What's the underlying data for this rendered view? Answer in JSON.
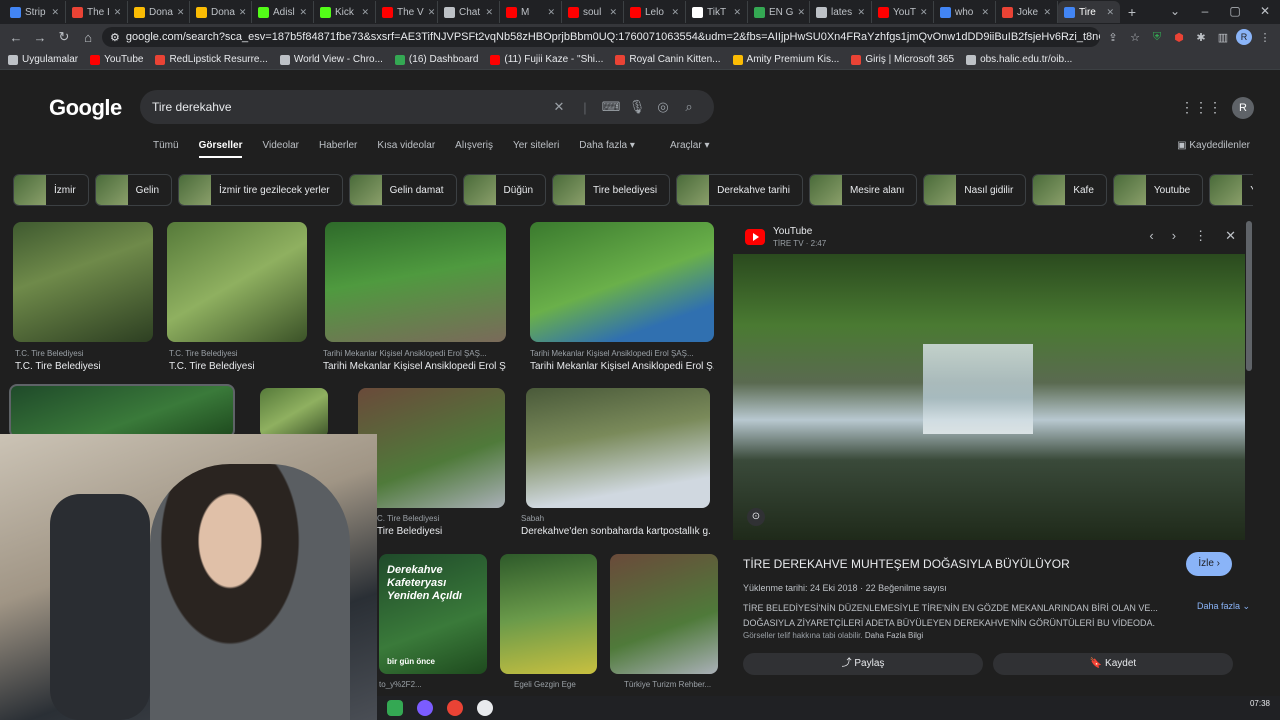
{
  "browser": {
    "tabs": [
      {
        "label": "Strip",
        "color": "#4285f4"
      },
      {
        "label": "The I",
        "color": "#ea4335"
      },
      {
        "label": "Dona",
        "color": "#fbbc04"
      },
      {
        "label": "Dona",
        "color": "#fbbc04"
      },
      {
        "label": "Adisl",
        "color": "#53fc18"
      },
      {
        "label": "Kick",
        "color": "#53fc18"
      },
      {
        "label": "The V",
        "color": "#ff0000"
      },
      {
        "label": "Chat",
        "color": "#bdc1c6"
      },
      {
        "label": "M",
        "color": "#ff0000"
      },
      {
        "label": "soul",
        "color": "#ff0000"
      },
      {
        "label": "Lelo",
        "color": "#ff0000"
      },
      {
        "label": "TikT",
        "color": "#ffffff"
      },
      {
        "label": "EN G",
        "color": "#34a853"
      },
      {
        "label": "lates",
        "color": "#bdc1c6"
      },
      {
        "label": "YouT",
        "color": "#ff0000"
      },
      {
        "label": "who",
        "color": "#4285f4"
      },
      {
        "label": "Joke",
        "color": "#ea4335"
      },
      {
        "label": "Tire",
        "color": "#4285f4",
        "active": true
      }
    ],
    "url": "google.com/search?sca_esv=187b5f84871fbe73&sxsrf=AE3TifNJVPSFt2vqNb58zHBOprjbBbm0UQ:1760071063554&udm=2&fbs=AIIjpHwSU0Xn4FRaYzhfgs1jmQvOnw1dDD9iiBuIB2fsjeHv6Rzi_t8nCYrA3VAYvcClsvbRO6GKb...",
    "bookmarks": [
      {
        "label": "Uygulamalar",
        "color": "#bdc1c6"
      },
      {
        "label": "YouTube",
        "color": "#ff0000"
      },
      {
        "label": "RedLipstick Resurre...",
        "color": "#ea4335"
      },
      {
        "label": "World View - Chro...",
        "color": "#bdc1c6"
      },
      {
        "label": "(16) Dashboard",
        "color": "#34a853"
      },
      {
        "label": "(11) Fujii Kaze - \"Shi...",
        "color": "#ff0000"
      },
      {
        "label": "Royal Canin Kitten...",
        "color": "#ea4335"
      },
      {
        "label": "Amity Premium Kis...",
        "color": "#fbbc04"
      },
      {
        "label": "Giriş | Microsoft 365",
        "color": "#ea4335"
      },
      {
        "label": "obs.halic.edu.tr/oib...",
        "color": "#bdc1c6"
      }
    ]
  },
  "google": {
    "logo": "Google",
    "query": "Tire derekahve",
    "tabs": [
      "Tümü",
      "Görseller",
      "Videolar",
      "Haberler",
      "Kısa videolar",
      "Alışveriş",
      "Yer siteleri",
      "Daha fazla ▾"
    ],
    "tools": "Araçlar ▾",
    "saved": "Kaydedilenler",
    "chips": [
      "İzmir",
      "Gelin",
      "İzmir tire gezilecek yerler",
      "Gelin damat",
      "Düğün",
      "Tire belediyesi",
      "Derekahve tarihi",
      "Mesire alanı",
      "Nasıl gidilir",
      "Kafe",
      "Youtube",
      "Yol tarifi"
    ]
  },
  "results": [
    {
      "source": "T.C. Tire Belediyesi",
      "caption": "T.C. Tire Belediyesi"
    },
    {
      "source": "T.C. Tire Belediyesi",
      "caption": "T.C. Tire Belediyesi"
    },
    {
      "source": "Tarihi Mekanlar Kişisel Ansiklopedi Erol ŞAŞ...",
      "caption": "Tarihi Mekanlar Kişisel Ansiklopedi Erol Ş..."
    },
    {
      "source": "Tarihi Mekanlar Kişisel Ansiklopedi Erol ŞAŞ...",
      "caption": "Tarihi Mekanlar Kişisel Ansiklopedi Erol Ş..."
    },
    {
      "source": "C. Tire Belediyesi",
      "caption": "Tire Belediyesi"
    },
    {
      "source": "Sabah",
      "caption": "Derekahve'den sonbaharda kartpostallık g..."
    },
    {
      "source": "to_y%2F2...",
      "caption": ""
    },
    {
      "source": "Egeli Gezgin Ege",
      "caption": ""
    },
    {
      "source": "Türkiye Turizm Rehber...",
      "caption": ""
    }
  ],
  "preview": {
    "site": "YouTube",
    "channel": "TİRE TV · 2:47",
    "title": "TİRE DEREKAHVE MUHTEŞEM DOĞASIYLA BÜYÜLÜYOR",
    "visit": "İzle ›",
    "meta": "Yüklenme tarihi: 24 Eki 2018 · 22 Beğenilme sayısı",
    "description": "TİRE BELEDİYESİ'NİN DÜZENLEMESİYLE TİRE'NİN EN GÖZDE MEKANLARINDAN BİRİ OLAN VE... DOĞASIYLA ZİYARETÇİLERİ ADETA BÜYÜLEYEN DEREKAHVE'NİN GÖRÜNTÜLERİ BU VİDEODA.",
    "more": "Daha fazla",
    "copyright": "Görseller telif hakkına tabi olabilir.",
    "copyright_link": "Daha Fazla Bilgi",
    "share": "Paylaş",
    "save": "Kaydet"
  },
  "thumb_badge": "bir gün önce",
  "thumb_title": "Derekahve Kafeteryası Yeniden Açıldı",
  "clock": "07:38"
}
